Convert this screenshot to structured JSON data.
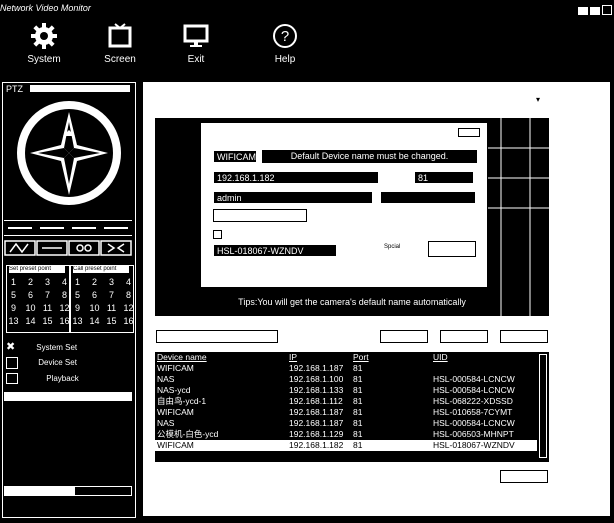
{
  "window": {
    "title": "Network Video Monitor"
  },
  "toolbar": {
    "system": "System",
    "screen": "Screen",
    "exit": "Exit",
    "help": "Help"
  },
  "ptz": {
    "tab_label": "PTZ"
  },
  "preset_groups": {
    "left_title": "Set preset point",
    "right_title": "Call preset point",
    "left_numbers": [
      "1",
      "2",
      "3",
      "4",
      "5",
      "6",
      "7",
      "8",
      "9",
      "10",
      "11",
      "12",
      "13",
      "14",
      "15",
      "16"
    ],
    "right_numbers": [
      "1",
      "2",
      "3",
      "4",
      "5",
      "6",
      "7",
      "8",
      "9",
      "10",
      "11",
      "12",
      "13",
      "14",
      "15",
      "16"
    ]
  },
  "side_menu": {
    "system_set": "System Set",
    "device_set": "Device Set",
    "playback": "Playback"
  },
  "dialog": {
    "name_value": "WIFICAM",
    "notice": "Default Device name must be changed.",
    "ip_value": "192.168.1.182",
    "port_value": "81",
    "user_value": "admin",
    "uid_value": "HSL-018067-WZNDV",
    "mode_label": "Spcial"
  },
  "tip": "Tips:You will get the camera's default name automatically",
  "device_table": {
    "headers": [
      "Device name",
      "IP",
      "Port",
      "UID"
    ],
    "rows": [
      [
        "WIFICAM",
        "192.168.1.187",
        "81",
        ""
      ],
      [
        "NAS",
        "192.168.1.100",
        "81",
        "HSL-000584-LCNCW"
      ],
      [
        "NAS-ycd",
        "192.168.1.133",
        "81",
        "HSL-000584-LCNCW"
      ],
      [
        "自由鸟-ycd-1",
        "192.168.1.112",
        "81",
        "HSL-068222-XDSSD"
      ],
      [
        "WIFICAM",
        "192.168.1.187",
        "81",
        "HSL-010658-7CYMT"
      ],
      [
        "NAS",
        "192.168.1.187",
        "81",
        "HSL-000584-LCNCW"
      ],
      [
        "公模机-白色-ycd",
        "192.168.1.129",
        "81",
        "HSL-006503-MHNPT"
      ],
      [
        "WIFICAM",
        "192.168.1.182",
        "81",
        "HSL-018067-WZNDV"
      ]
    ]
  }
}
